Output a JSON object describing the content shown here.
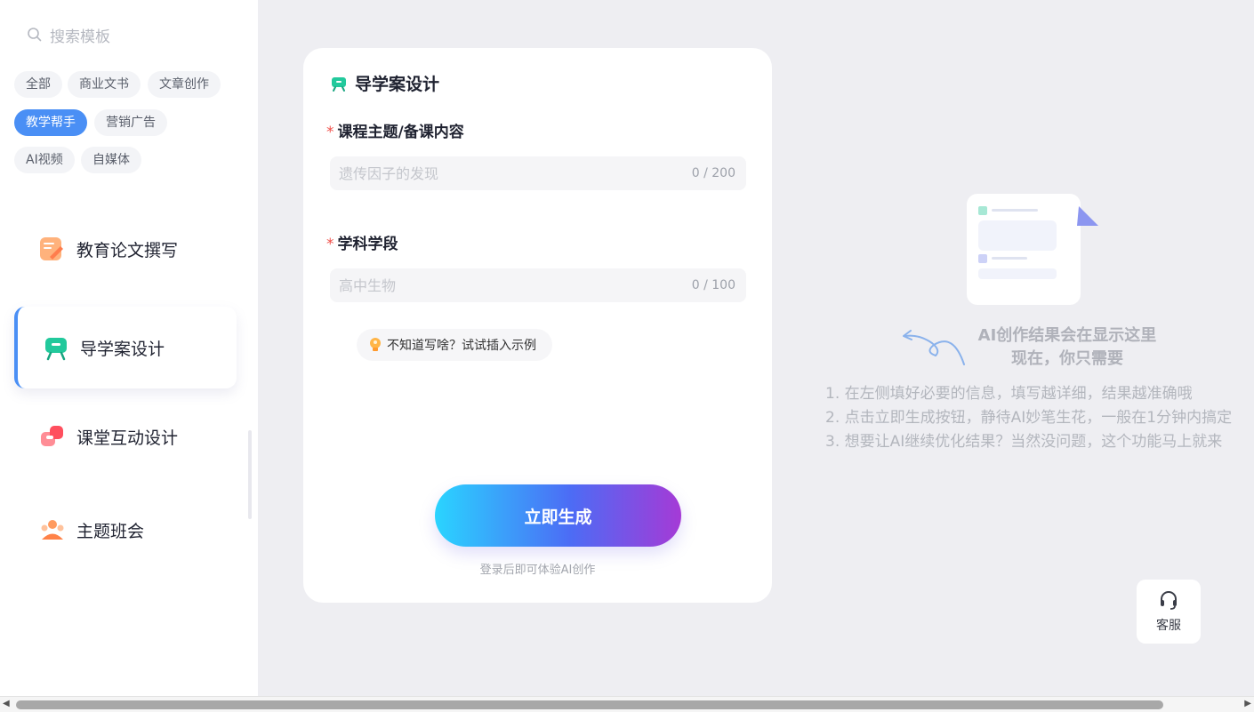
{
  "search": {
    "placeholder": "搜索模板"
  },
  "categories": [
    {
      "label": "全部"
    },
    {
      "label": "商业文书"
    },
    {
      "label": "文章创作"
    },
    {
      "label": "教学帮手"
    },
    {
      "label": "营销广告"
    },
    {
      "label": "AI视频"
    },
    {
      "label": "自媒体"
    }
  ],
  "active_category": "教学帮手",
  "templates": [
    {
      "label": "教育论文撰写",
      "icon": "edit-paper-icon"
    },
    {
      "label": "导学案设计",
      "icon": "easel-icon"
    },
    {
      "label": "课堂互动设计",
      "icon": "interaction-blocks-icon"
    },
    {
      "label": "主题班会",
      "icon": "class-meeting-icon"
    }
  ],
  "active_template": "导学案设计",
  "form": {
    "title": "导学案设计",
    "field1": {
      "label": "课程主题/备课内容",
      "placeholder": "遗传因子的发现",
      "counter": "0 / 200"
    },
    "field2": {
      "label": "学科学段",
      "placeholder": "高中生物",
      "counter": "0 / 100"
    },
    "required_mark": "*",
    "hint": "不知道写啥？试试插入示例",
    "generate_label": "立即生成",
    "login_note": "登录后即可体验AI创作"
  },
  "result": {
    "title_line1": "AI创作结果会在显示这里",
    "title_line2": "现在，你只需要",
    "steps": [
      "1. 在左侧填好必要的信息，填写越详细，结果越准确哦",
      "2. 点击立即生成按钮，静待AI妙笔生花，一般在1分钟内搞定",
      "3. 想要让AI继续优化结果？当然没问题，这个功能马上就来"
    ]
  },
  "support": {
    "label": "客服"
  },
  "colors": {
    "accent": "#4a8ff5",
    "required": "#f0504a"
  }
}
